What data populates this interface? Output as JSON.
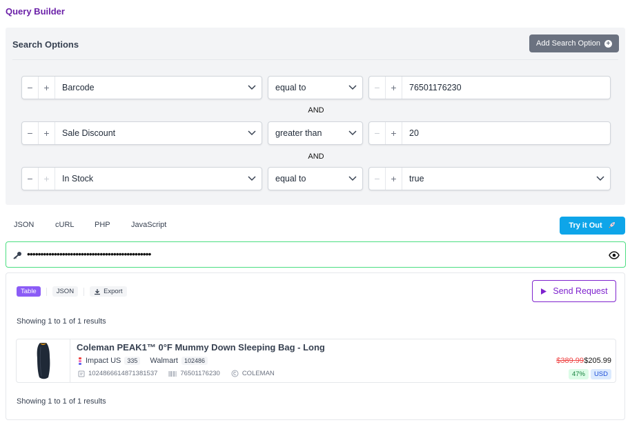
{
  "title": "Query Builder",
  "search_options": {
    "title": "Search Options",
    "add_button_label": "Add Search Option",
    "rows": [
      {
        "field": "Barcode",
        "operator": "equal to",
        "value": "76501176230",
        "value_type": "text"
      },
      {
        "field": "Sale Discount",
        "operator": "greater than",
        "value": "20",
        "value_type": "text"
      },
      {
        "field": "In Stock",
        "operator": "equal to",
        "value": "true",
        "value_type": "select"
      }
    ],
    "connector": "AND"
  },
  "code_tabs": [
    "JSON",
    "cURL",
    "PHP",
    "JavaScript"
  ],
  "try_button_label": "Try it Out",
  "api_key_masked": "••••••••••••••••••••••••••••••••••••••••••••••",
  "results": {
    "view_tabs": {
      "table": "Table",
      "json": "JSON",
      "export": "Export"
    },
    "send_button_label": "Send Request",
    "showing_text": "Showing 1 to 1 of 1 results",
    "product": {
      "title": "Coleman PEAK1™ 0°F Mummy Down Sleeping Bag - Long",
      "source1": "Impact US",
      "source1_count": "335",
      "source2": "Walmart",
      "source2_id": "102486",
      "id": "1024866614871381537",
      "barcode": "76501176230",
      "brand": "COLEMAN",
      "old_price": "$389.99",
      "price": "$205.99",
      "discount": "47%",
      "currency": "USD"
    }
  }
}
